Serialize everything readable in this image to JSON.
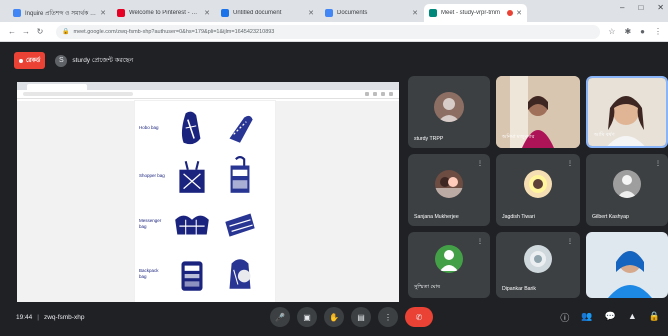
{
  "browser": {
    "tabs": [
      {
        "title": "Inquire প্রতিশব্দ ও সমার্থক শব্দ",
        "color": "#4285f4",
        "active": false
      },
      {
        "title": "Welcome to Pinterest - Sign in",
        "color": "#e60023",
        "active": false
      },
      {
        "title": "Untitled document",
        "color": "#1a73e8",
        "active": false
      },
      {
        "title": "Documents",
        "color": "#4285f4",
        "active": false
      },
      {
        "title": "Meet - study-vrpr-tmm",
        "color": "#00897b",
        "active": true
      }
    ],
    "url": "meet.google.com/zwq-fsmb-xhp?authuser=0&hs=179&pli=1&ijlm=1645423210893",
    "nav": {
      "back": "←",
      "forward": "→",
      "reload": "↻",
      "lock": "🔒"
    },
    "window_controls": {
      "minimize": "–",
      "maximize": "□",
      "close": "✕"
    },
    "toolbar_icons": {
      "star": "☆",
      "ext": "✱",
      "menu": "⋮",
      "profile": "●"
    }
  },
  "meet": {
    "rec_label": "রেকর্ড",
    "presenter": {
      "initial": "S",
      "label": "sturdy প্রেজেন্ট করছেন"
    },
    "participants": [
      {
        "name": "sturdy TRPP",
        "avatar_bg": "#8d6e63",
        "kind": "avatar",
        "mic_muted": false
      },
      {
        "name": "অনিমা মজুমদার",
        "avatar_bg": "#e6a19c",
        "kind": "video-warm",
        "mic_muted": true
      },
      {
        "name": "আমি বর্ষণ",
        "avatar_bg": "#c9a27a",
        "kind": "video-light",
        "mic_muted": false
      },
      {
        "name": "Sanjana Mukherjee",
        "avatar_bg": "#6d4c41",
        "kind": "avatar",
        "mic_muted": true
      },
      {
        "name": "Jagdish Tiwari",
        "avatar_bg": "#f5deb3",
        "kind": "avatar",
        "mic_muted": true
      },
      {
        "name": "Gilbert Kashyap",
        "avatar_bg": "#9e9e9e",
        "kind": "avatar",
        "mic_muted": true
      },
      {
        "name": "সুস্মিতা ঘোষ",
        "avatar_bg": "#43a047",
        "kind": "avatar",
        "mic_muted": true
      },
      {
        "name": "Dipankar Barik",
        "avatar_bg": "#cfd8dc",
        "kind": "avatar",
        "mic_muted": true
      },
      {
        "name": "",
        "avatar_bg": "#8ab4f8",
        "kind": "video-blue",
        "mic_muted": false
      }
    ],
    "document_labels": [
      "Hobo bag",
      "Shopper bag",
      "Messenger bag",
      "Backpack bag"
    ],
    "time": "19:44",
    "meeting_code": "zwq-fsmb-xhp",
    "sep": "|",
    "controls": {
      "mic": "🎤",
      "cam": "▣",
      "hand": "✋",
      "present": "▤",
      "more": "⋮",
      "end": "✆"
    },
    "right_icons": {
      "info": "ⓘ",
      "people": "👥",
      "chat": "💬",
      "activities": "▲",
      "lock": "🔒"
    },
    "colors": {
      "background": "#202124",
      "tile": "#3c4043",
      "end_call": "#ea4335",
      "accent_blue": "#1a73e8"
    }
  }
}
